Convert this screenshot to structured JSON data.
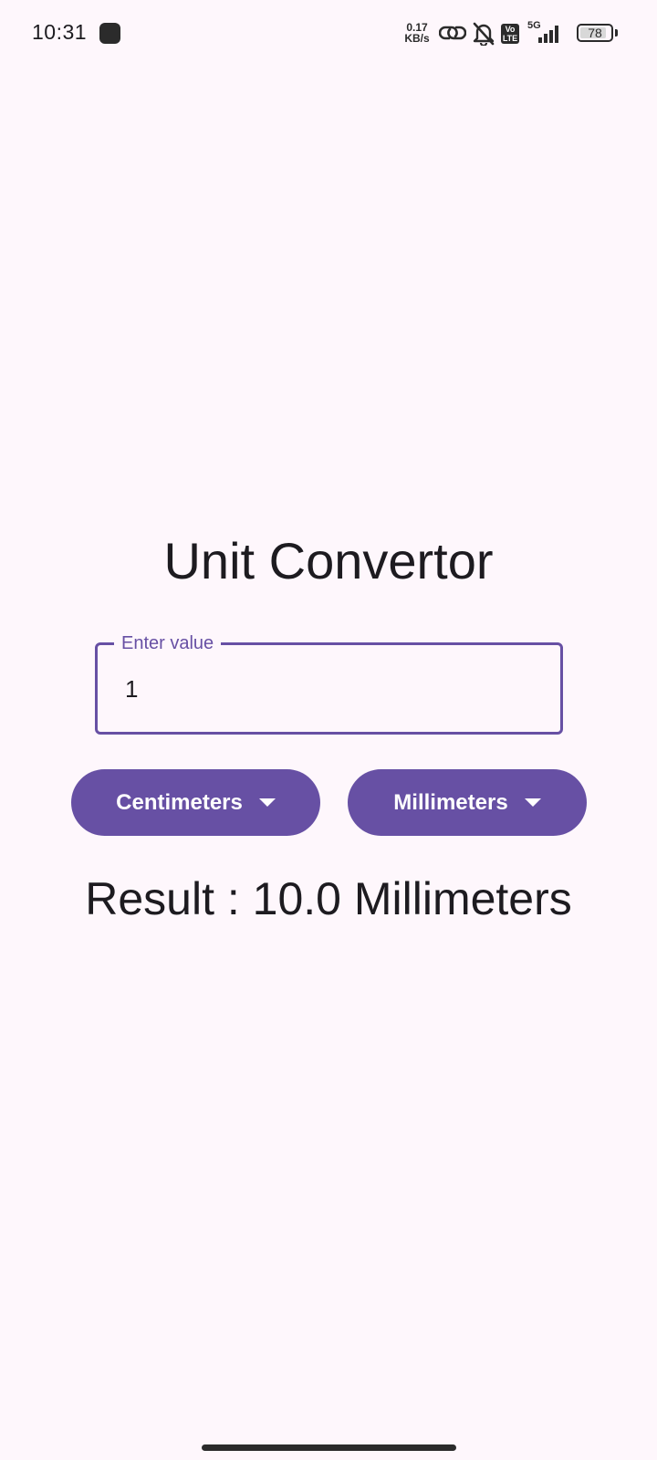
{
  "status_bar": {
    "time": "10:31",
    "net_speed_value": "0.17",
    "net_speed_unit": "KB/s",
    "network_type": "5G",
    "volte_label_top": "Vo",
    "volte_label_bottom": "LTE",
    "battery_level": "78",
    "icons": [
      "app-notification-icon",
      "link-icon",
      "bell-muted-icon",
      "volte-icon",
      "signal-5g-icon",
      "battery-icon"
    ]
  },
  "app": {
    "title": "Unit Convertor",
    "input": {
      "label": "Enter value",
      "value": "1",
      "placeholder": ""
    },
    "from_unit": {
      "selected": "Centimeters",
      "icon": "arrow-drop-down-icon"
    },
    "to_unit": {
      "selected": "Millimeters",
      "icon": "arrow-drop-down-icon"
    },
    "result_text": "Result : 10.0 Millimeters"
  },
  "colors": {
    "background": "#FEF7FC",
    "primary": "#6750A4",
    "on_primary": "#FFFFFF",
    "text": "#1D1B20"
  }
}
